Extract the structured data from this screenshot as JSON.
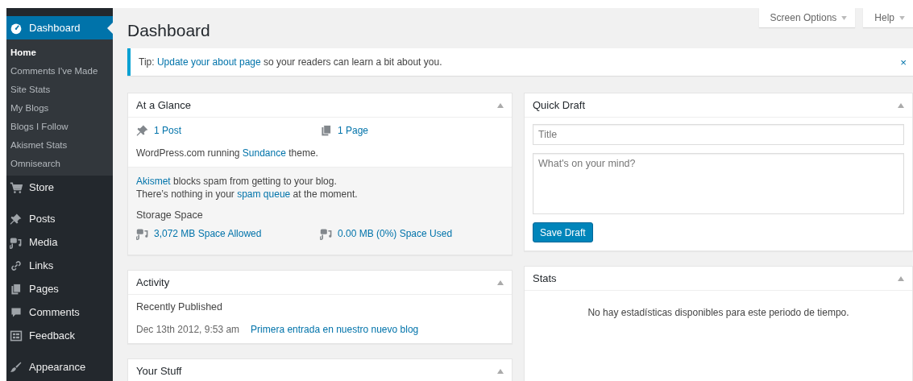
{
  "sidebar": {
    "sections": [
      [
        {
          "label": "Dashboard",
          "selected": true,
          "children": [
            {
              "label": "Home",
              "selected": true
            },
            {
              "label": "Comments I've Made",
              "selected": false
            },
            {
              "label": "Site Stats",
              "selected": false
            },
            {
              "label": "My Blogs",
              "selected": false
            },
            {
              "label": "Blogs I Follow",
              "selected": false
            },
            {
              "label": "Akismet Stats",
              "selected": false
            },
            {
              "label": "Omnisearch",
              "selected": false
            }
          ]
        },
        {
          "label": "Store",
          "selected": false
        }
      ],
      [
        {
          "label": "Posts",
          "selected": false
        },
        {
          "label": "Media",
          "selected": false
        },
        {
          "label": "Links",
          "selected": false
        },
        {
          "label": "Pages",
          "selected": false
        },
        {
          "label": "Comments",
          "selected": false
        },
        {
          "label": "Feedback",
          "selected": false
        }
      ],
      [
        {
          "label": "Appearance",
          "selected": false
        }
      ]
    ]
  },
  "header": {
    "title": "Dashboard",
    "tabs": [
      "Screen Options",
      "Help"
    ]
  },
  "notice": {
    "parts": [
      {
        "text": "Tip: ",
        "link": false
      },
      {
        "text": "Update your about page",
        "link": true
      },
      {
        "text": " so your readers can learn a bit about you.",
        "link": false
      }
    ],
    "dismiss": "×"
  },
  "at_a_glance": {
    "title": "At a Glance",
    "counts": [
      "1 Post",
      "1 Page"
    ],
    "theme_line": [
      {
        "text": "WordPress.com running ",
        "link": false
      },
      {
        "text": "Sundance",
        "link": true
      },
      {
        "text": " theme.",
        "link": false
      }
    ],
    "akismet_lines": [
      [
        {
          "text": "Akismet",
          "link": true
        },
        {
          "text": " blocks spam from getting to your blog.",
          "link": false
        }
      ],
      [
        {
          "text": "There’s nothing in your ",
          "link": false
        },
        {
          "text": "spam queue",
          "link": true
        },
        {
          "text": " at the moment.",
          "link": false
        }
      ]
    ],
    "storage_title": "Storage Space",
    "storage": [
      "3,072 MB Space Allowed",
      "0.00 MB (0%) Space Used"
    ]
  },
  "activity": {
    "title": "Activity",
    "heading": "Recently Published",
    "posts": [
      {
        "date": "Dec 13th 2012, 9:53 am",
        "title": "Primera entrada en nuestro nuevo blog"
      }
    ]
  },
  "your_stuff": {
    "title": "Your Stuff"
  },
  "quick_draft": {
    "title": "Quick Draft",
    "title_placeholder": "Title",
    "content_placeholder": "What's on your mind?",
    "button": "Save Draft"
  },
  "stats": {
    "title": "Stats",
    "message": "No hay estadísticas disponibles para este periodo de tiempo."
  }
}
